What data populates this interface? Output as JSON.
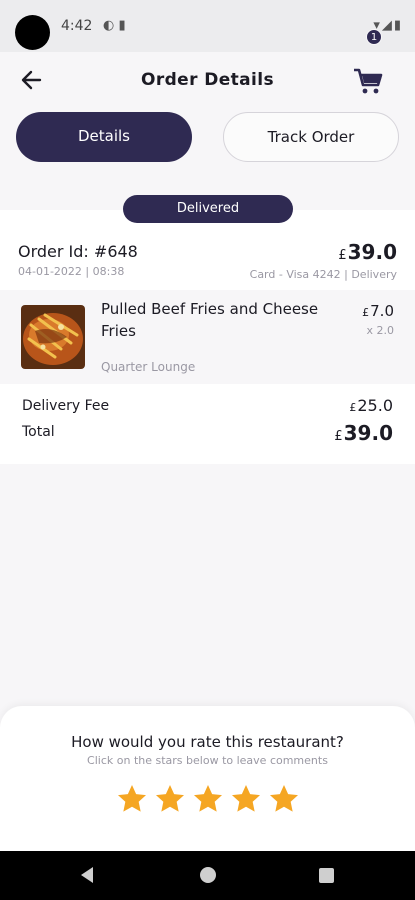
{
  "status_bar": {
    "time": "4:42",
    "left_icons": "◐ ▮",
    "right_icons": "▾◢▮"
  },
  "header": {
    "title": "Order Details",
    "cart_count": "1"
  },
  "tabs": [
    {
      "label": "Details",
      "active": true
    },
    {
      "label": "Track Order",
      "active": false
    }
  ],
  "order": {
    "status": "Delivered",
    "id_label": "Order Id: #648",
    "date": "04-01-2022 | 08:38",
    "currency": "£",
    "total": "39.0",
    "payment": "Card - Visa 4242 | Delivery"
  },
  "items": [
    {
      "name": "Pulled Beef Fries and Cheese Fries",
      "restaurant": "Quarter Lounge",
      "price": "7.0",
      "qty": "x 2.0"
    }
  ],
  "summary": {
    "delivery_fee_label": "Delivery Fee",
    "delivery_fee": "25.0",
    "total_label": "Total",
    "total": "39.0"
  },
  "rating": {
    "question": "How would you rate this restaurant?",
    "hint": "Click on the stars below to leave comments",
    "stars": 5
  },
  "colors": {
    "primary": "#2f2a52",
    "star": "#f5a623",
    "muted": "#9a98a3"
  },
  "icons": {
    "back": "back-arrow-icon",
    "cart": "cart-icon",
    "star": "star-icon"
  }
}
